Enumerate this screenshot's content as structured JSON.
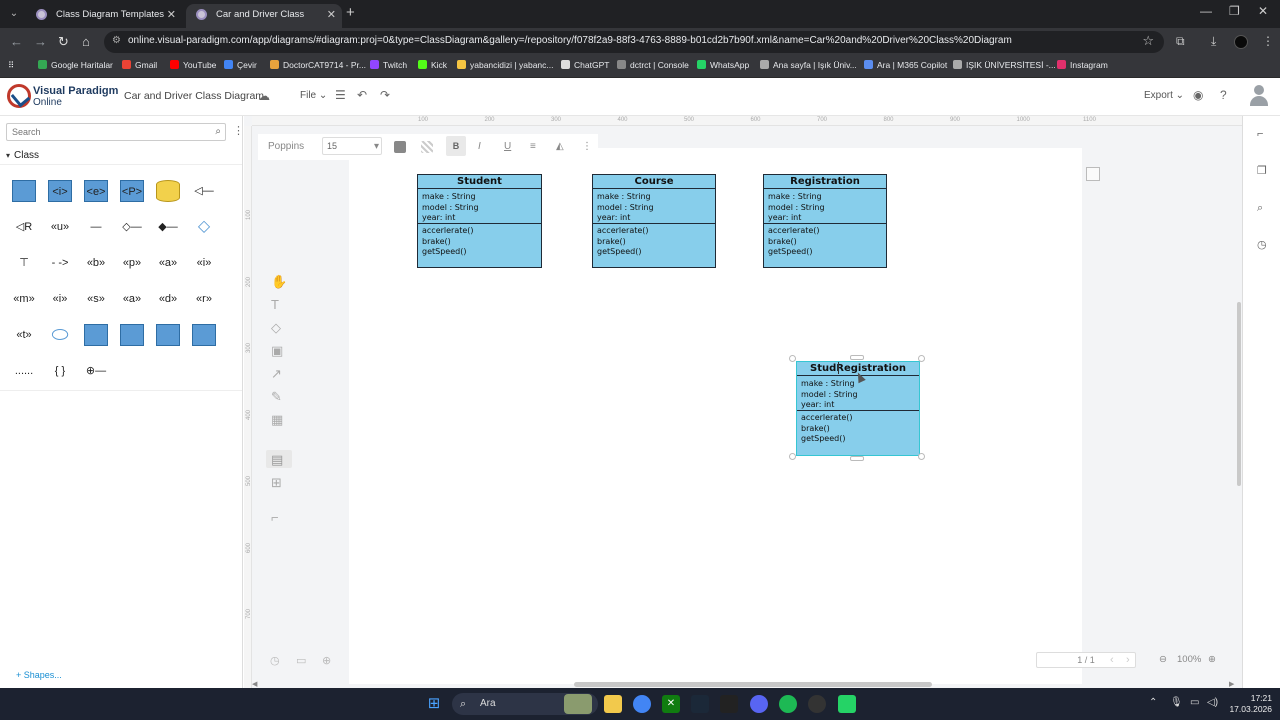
{
  "browser": {
    "tabs": [
      {
        "title": "Class Diagram Templates",
        "active": false
      },
      {
        "title": "Car and Driver Class Diagram |",
        "active": true
      }
    ],
    "url": "online.visual-paradigm.com/app/diagrams/#diagram:proj=0&type=ClassDiagram&gallery=/repository/f078f2a9-88f3-4763-8889-b01cd2b7b90f.xml&name=Car%20and%20Driver%20Class%20Diagram",
    "bookmarks": [
      {
        "label": "Google Haritalar",
        "color": "#34a853"
      },
      {
        "label": "Gmail",
        "color": "#ea4335"
      },
      {
        "label": "YouTube",
        "color": "#ff0000"
      },
      {
        "label": "Çevir",
        "color": "#4285f4"
      },
      {
        "label": "DoctorCAT9714 - Pr...",
        "color": "#e8a33d"
      },
      {
        "label": "Twitch",
        "color": "#9146ff"
      },
      {
        "label": "Kick",
        "color": "#53fc18"
      },
      {
        "label": "yabancidizi | yabanc...",
        "color": "#f5c542"
      },
      {
        "label": "ChatGPT",
        "color": "#dddddd"
      },
      {
        "label": "dctrct | Console",
        "color": "#888888"
      },
      {
        "label": "WhatsApp",
        "color": "#25d366"
      },
      {
        "label": "Ana sayfa | Işık Üniv...",
        "color": "#aaaaaa"
      },
      {
        "label": "Ara | M365 Copilot",
        "color": "#5b8def"
      },
      {
        "label": "IŞIK ÜNİVERSİTESİ -...",
        "color": "#aaaaaa"
      },
      {
        "label": "Instagram",
        "color": "#e1306c"
      }
    ]
  },
  "app": {
    "logo_line1": "Visual Paradigm",
    "logo_line2": "Online",
    "doc_title": "Car and Driver Class Diagram",
    "file_menu": "File",
    "export_label": "Export"
  },
  "sidebar": {
    "search_placeholder": "Search",
    "category": "Class",
    "shapes_link": "Shapes...",
    "shape_glyphs": [
      "",
      "<i>",
      "<e>",
      "<P>",
      "",
      "◁—",
      "◁R",
      "«u»",
      "—",
      "◇—",
      "◆—",
      "◇",
      "⊤",
      "- ->",
      "«b»",
      "«p»",
      "«a»",
      "«i»",
      "«m»",
      "«i»",
      "«s»",
      "«a»",
      "«d»",
      "«r»",
      "«t»",
      "⬭",
      "",
      "",
      "",
      "",
      "......",
      "{ }",
      "⊕—"
    ]
  },
  "formatbar": {
    "font": "Poppins",
    "size": "15",
    "bold": "B",
    "italic": "I",
    "underline": "U"
  },
  "diagram": {
    "classes": [
      {
        "name": "Student",
        "attrs": [
          "make : String",
          "model : String",
          "year: int"
        ],
        "ops": [
          "accerlerate()",
          "brake()",
          "getSpeed()"
        ]
      },
      {
        "name": "Course",
        "attrs": [
          "make : String",
          "model : String",
          "year: int"
        ],
        "ops": [
          "accerlerate()",
          "brake()",
          "getSpeed()"
        ]
      },
      {
        "name": "Registration",
        "attrs": [
          "make : String",
          "model : String",
          "year: int"
        ],
        "ops": [
          "accerlerate()",
          "brake()",
          "getSpeed()"
        ]
      },
      {
        "name": "StudRegistration",
        "attrs": [
          "make : String",
          "model : String",
          "year: int"
        ],
        "ops": [
          "accerlerate()",
          "brake()",
          "getSpeed()"
        ]
      }
    ],
    "fill_color": "#87ceeb"
  },
  "ruler_marks": [
    "100",
    "200",
    "300",
    "400",
    "500",
    "600",
    "700",
    "800",
    "900",
    "1000",
    "1100"
  ],
  "ruler_left_marks": [
    "100",
    "200",
    "300",
    "400",
    "500",
    "600",
    "700"
  ],
  "status": {
    "page": "1 / 1",
    "zoom": "100%"
  },
  "taskbar": {
    "search": "Ara",
    "time": "17:21",
    "date": "17.03.2026"
  }
}
